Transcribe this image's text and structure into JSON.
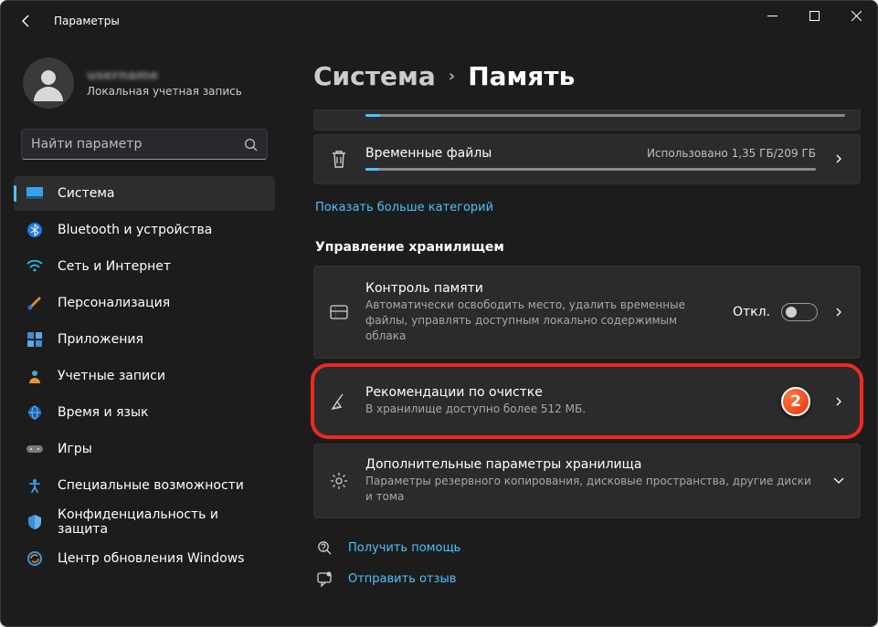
{
  "window": {
    "title": "Параметры"
  },
  "user": {
    "name": "username",
    "subtitle": "Локальная учетная запись"
  },
  "search": {
    "placeholder": "Найти параметр"
  },
  "nav": {
    "items": [
      {
        "label": "Система"
      },
      {
        "label": "Bluetooth и устройства"
      },
      {
        "label": "Сеть и Интернет"
      },
      {
        "label": "Персонализация"
      },
      {
        "label": "Приложения"
      },
      {
        "label": "Учетные записи"
      },
      {
        "label": "Время и язык"
      },
      {
        "label": "Игры"
      },
      {
        "label": "Специальные возможности"
      },
      {
        "label": "Конфиденциальность и защита"
      },
      {
        "label": "Центр обновления Windows"
      }
    ]
  },
  "breadcrumb": {
    "parent": "Система",
    "current": "Память"
  },
  "temp_files": {
    "title": "Временные файлы",
    "usage": "Использовано 1,35 ГБ/209 ГБ",
    "fill_percent": 3
  },
  "show_more": "Показать больше категорий",
  "storage_mgmt_title": "Управление хранилищем",
  "storage_sense": {
    "title": "Контроль памяти",
    "subtitle": "Автоматически освободить место, удалить временные файлы, управлять доступным локально содержимым облака",
    "toggle_label": "Откл."
  },
  "cleanup": {
    "title": "Рекомендации по очистке",
    "subtitle": "В хранилище доступно более 512 МБ.",
    "marker": "2"
  },
  "advanced": {
    "title": "Дополнительные параметры хранилища",
    "subtitle": "Параметры резервного копирования, дисковые пространства, другие диски и тома"
  },
  "help": {
    "get_help": "Получить помощь",
    "feedback": "Отправить отзыв"
  }
}
